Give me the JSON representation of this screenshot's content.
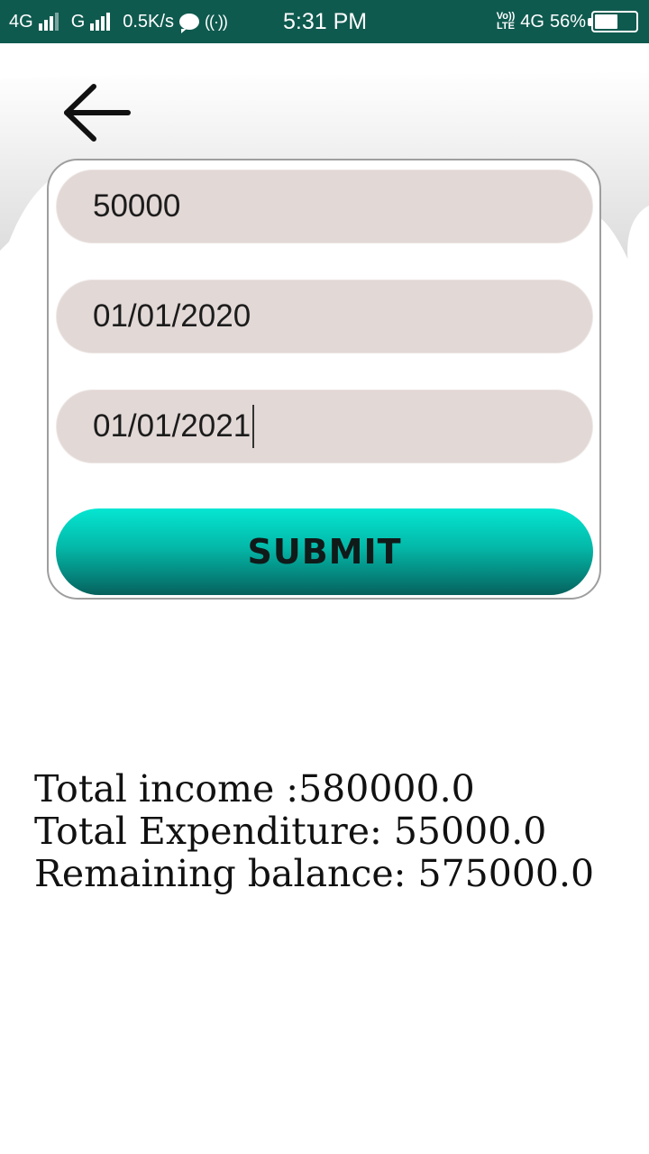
{
  "status_bar": {
    "network1": "4G",
    "network2": "G",
    "speed": "0.5K/s",
    "time": "5:31 PM",
    "volte_top": "Vo))",
    "volte_bottom": "LTE",
    "network3": "4G",
    "battery": "56%",
    "battery_level": 0.56,
    "bg_color": "#0f5a4f"
  },
  "form": {
    "amount_value": "50000",
    "start_date_value": "01/01/2020",
    "end_date_value": "01/01/2021",
    "submit_label": "SUBMIT",
    "field_color": "#e2d8d6",
    "accent_color": "#05e6d2"
  },
  "results": {
    "total_income": "Total income :580000.0",
    "total_expenditure": "Total Expenditure: 55000.0",
    "remaining_balance": "Remaining balance: 575000.0"
  },
  "icons": {
    "back": "arrow-left-icon"
  }
}
